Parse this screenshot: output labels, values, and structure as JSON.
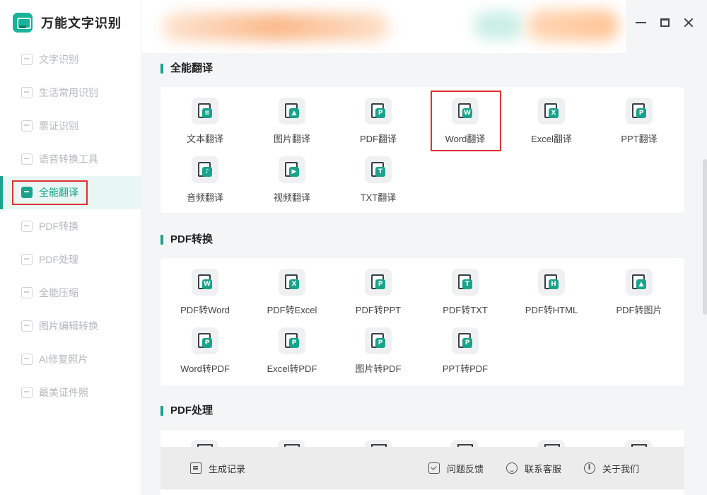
{
  "app": {
    "title": "万能文字识别"
  },
  "sidebar": {
    "items": [
      {
        "label": "文字识别",
        "icon": "text-scan-icon"
      },
      {
        "label": "生活常用识别",
        "icon": "life-scan-icon"
      },
      {
        "label": "票证识别",
        "icon": "ticket-scan-icon"
      },
      {
        "label": "语音转换工具",
        "icon": "voice-convert-icon"
      },
      {
        "label": "全能翻译",
        "icon": "translate-icon",
        "active": true
      },
      {
        "label": "PDF转换",
        "icon": "pdf-convert-icon"
      },
      {
        "label": "PDF处理",
        "icon": "pdf-process-icon"
      },
      {
        "label": "全能压缩",
        "icon": "compress-icon"
      },
      {
        "label": "图片编辑转换",
        "icon": "image-edit-icon"
      },
      {
        "label": "AI修复照片",
        "icon": "ai-repair-icon"
      },
      {
        "label": "最美证件照",
        "icon": "id-photo-icon"
      }
    ]
  },
  "sections": {
    "translate": {
      "title": "全能翻译",
      "tools": [
        {
          "label": "文本翻译",
          "badge": "≡"
        },
        {
          "label": "图片翻译",
          "badge": "▲"
        },
        {
          "label": "PDF翻译",
          "badge": "P"
        },
        {
          "label": "Word翻译",
          "badge": "W",
          "highlighted": true
        },
        {
          "label": "Excel翻译",
          "badge": "X"
        },
        {
          "label": "PPT翻译",
          "badge": "P"
        },
        {
          "label": "音频翻译",
          "badge": "♪"
        },
        {
          "label": "视频翻译",
          "badge": "▶"
        },
        {
          "label": "TXT翻译",
          "badge": "T"
        }
      ]
    },
    "pdf_convert": {
      "title": "PDF转换",
      "tools": [
        {
          "label": "PDF转Word",
          "badge": "W"
        },
        {
          "label": "PDF转Excel",
          "badge": "X"
        },
        {
          "label": "PDF转PPT",
          "badge": "P"
        },
        {
          "label": "PDF转TXT",
          "badge": "T"
        },
        {
          "label": "PDF转HTML",
          "badge": "H"
        },
        {
          "label": "PDF转图片",
          "badge": "▲"
        },
        {
          "label": "Word转PDF",
          "badge": "P"
        },
        {
          "label": "Excel转PDF",
          "badge": "P"
        },
        {
          "label": "图片转PDF",
          "badge": "P"
        },
        {
          "label": "PPT转PDF",
          "badge": "P"
        }
      ]
    },
    "pdf_process": {
      "title": "PDF处理"
    }
  },
  "footer": {
    "records": "生成记录",
    "feedback": "问题反馈",
    "service": "联系客服",
    "about": "关于我们"
  },
  "colors": {
    "accent": "#1aa38c",
    "highlight": "#e03131"
  }
}
